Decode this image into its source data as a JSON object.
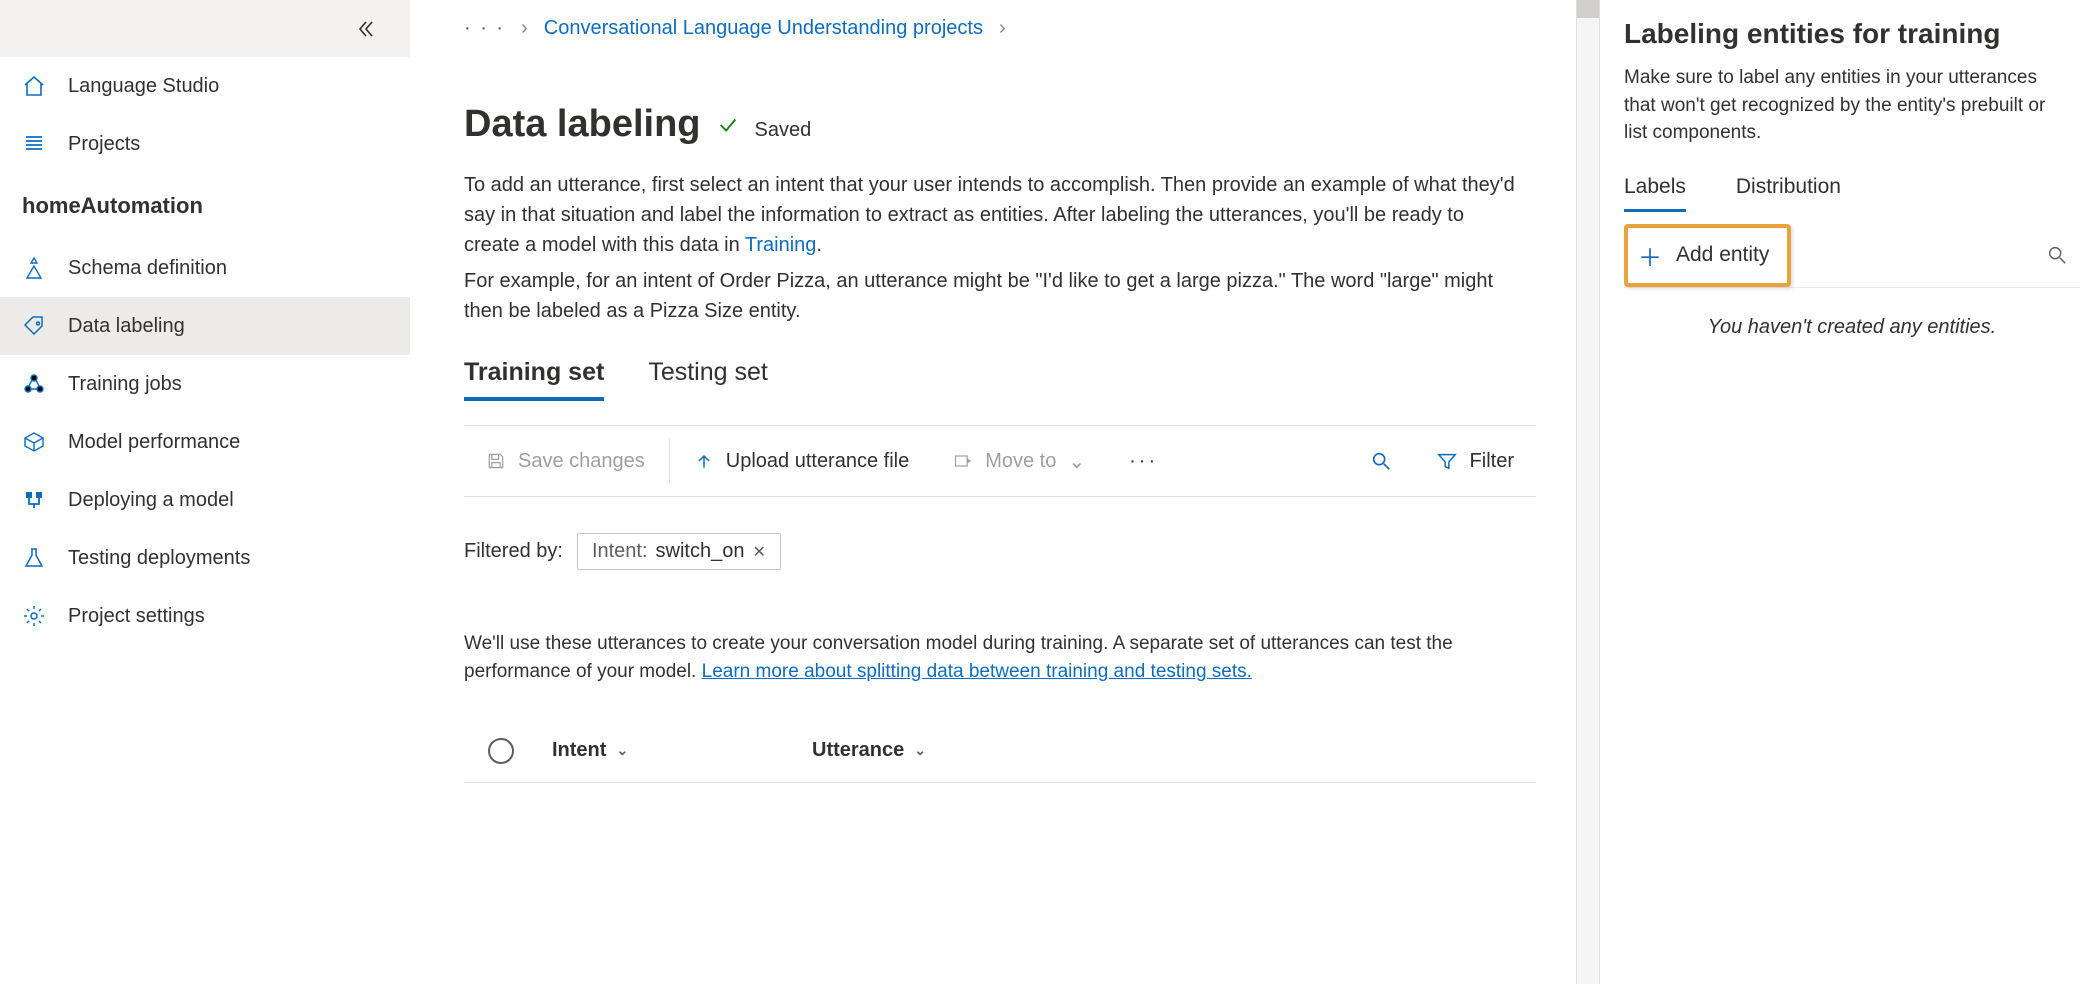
{
  "sidebar": {
    "top_items": [
      {
        "label": "Language Studio",
        "icon": "home-icon"
      },
      {
        "label": "Projects",
        "icon": "list-icon"
      }
    ],
    "project_name": "homeAutomation",
    "items": [
      {
        "label": "Schema definition",
        "icon": "schema-icon",
        "active": false
      },
      {
        "label": "Data labeling",
        "icon": "tag-icon",
        "active": true
      },
      {
        "label": "Training jobs",
        "icon": "cluster-icon",
        "active": false
      },
      {
        "label": "Model performance",
        "icon": "cube-icon",
        "active": false
      },
      {
        "label": "Deploying a model",
        "icon": "deploy-icon",
        "active": false
      },
      {
        "label": "Testing deployments",
        "icon": "flask-icon",
        "active": false
      },
      {
        "label": "Project settings",
        "icon": "gear-icon",
        "active": false
      }
    ]
  },
  "breadcrumb": {
    "ellipsis": "· · ·",
    "crumb": "Conversational Language Understanding projects"
  },
  "main": {
    "title": "Data labeling",
    "saved_label": "Saved",
    "intro_p1_before": "To add an utterance, first select an intent that your user intends to accomplish. Then provide an example of what they'd say in that situation and label the information to extract as entities. After labeling the utterances, you'll be ready to create a model with this data in ",
    "intro_p1_link": "Training",
    "intro_p1_after": ".",
    "intro_p2": "For example, for an intent of Order Pizza, an utterance might be \"I'd like to get a large pizza.\" The word \"large\" might then be labeled as a Pizza Size entity.",
    "tabs": [
      {
        "label": "Training set",
        "active": true
      },
      {
        "label": "Testing set",
        "active": false
      }
    ],
    "toolbar": {
      "save": "Save changes",
      "upload": "Upload utterance file",
      "moveto": "Move to",
      "filter": "Filter"
    },
    "filtered_by_label": "Filtered by:",
    "filter_pill_key": "Intent:",
    "filter_pill_val": "switch_on",
    "split_note_before": "We'll use these utterances to create your conversation model during training. A separate set of utterances can test the performance of your model. ",
    "split_note_link": "Learn more about splitting data between training and testing sets.",
    "table_cols": {
      "intent": "Intent",
      "utterance": "Utterance"
    }
  },
  "right": {
    "title": "Labeling entities for training",
    "desc": "Make sure to label any entities in your utterances that won't get recognized by the entity's prebuilt or list components.",
    "tabs": [
      {
        "label": "Labels",
        "active": true
      },
      {
        "label": "Distribution",
        "active": false
      }
    ],
    "add_entity_label": "Add entity",
    "empty_msg": "You haven't created any entities."
  }
}
